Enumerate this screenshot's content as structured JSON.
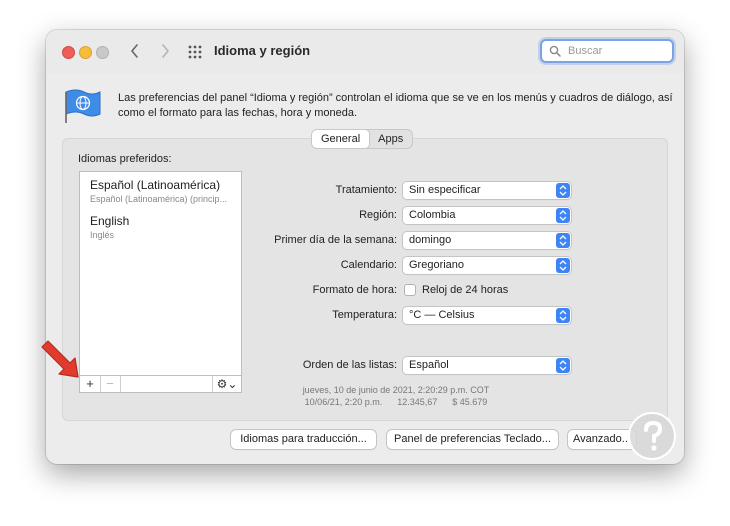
{
  "window": {
    "title": "Idioma y región"
  },
  "search": {
    "placeholder": "Buscar"
  },
  "description": "Las preferencias del panel “Idioma y región” controlan el idioma que se ve en los menús y cuadros de diálogo, así como el formato para las fechas, hora y moneda.",
  "tabs": [
    {
      "label": "General",
      "selected": true
    },
    {
      "label": "Apps",
      "selected": false
    }
  ],
  "preferred_languages": {
    "label": "Idiomas preferidos:",
    "items": [
      {
        "name": "Español (Latinoamérica)",
        "detail": "Español (Latinoamérica) (princip..."
      },
      {
        "name": "English",
        "detail": "Inglés"
      }
    ],
    "add_label": "+",
    "remove_label": "−",
    "gear_label": "⚙︎⌄"
  },
  "settings": {
    "tratamiento": {
      "label": "Tratamiento:",
      "value": "Sin especificar"
    },
    "region": {
      "label": "Región:",
      "value": "Colombia"
    },
    "primer_dia": {
      "label": "Primer día de la semana:",
      "value": "domingo"
    },
    "calendario": {
      "label": "Calendario:",
      "value": "Gregoriano"
    },
    "formato_hora": {
      "label": "Formato de hora:",
      "checkbox_label": "Reloj de 24 horas",
      "checked": false
    },
    "temperatura": {
      "label": "Temperatura:",
      "value": "°C — Celsius"
    },
    "orden_listas": {
      "label": "Orden de las listas:",
      "value": "Español"
    }
  },
  "samples": {
    "line1": "jueves, 10 de junio de 2021, 2:20:29 p.m. COT",
    "line2": "10/06/21, 2:20 p.m.      12.345,67      $ 45.679"
  },
  "buttons": {
    "idiomas_traduccion": "Idiomas para traducción...",
    "teclado": "Panel de preferencias Teclado...",
    "avanzado": "Avanzado..."
  },
  "colors": {
    "accent": "#3d84f7",
    "annotation_arrow": "#e23b2e"
  }
}
